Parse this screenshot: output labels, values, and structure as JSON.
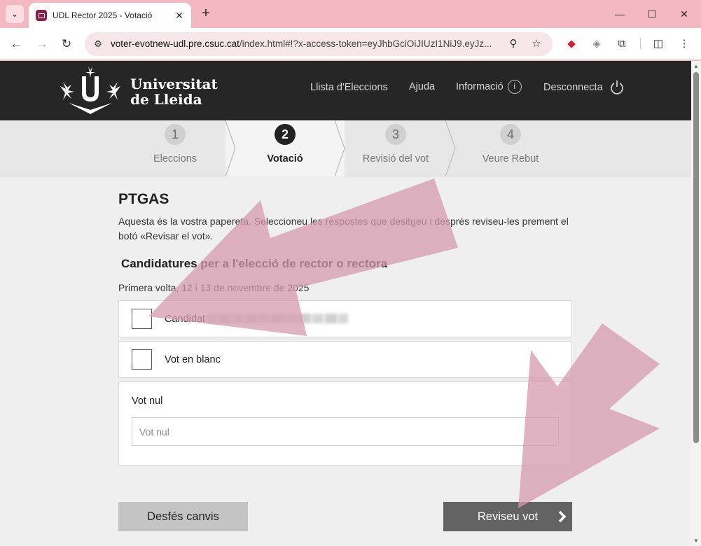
{
  "browser": {
    "tab_title": "UDL Rector 2025 - Votació",
    "url_host": "voter-evotnew-udl.pre.csuc.cat",
    "url_rest": "/index.html#!?x-access-token=eyJhbGciOiJIUzI1NiJ9.eyJz...",
    "icons": [
      "tab-list-icon",
      "close-icon",
      "plus-icon",
      "minimize-icon",
      "maximize-icon",
      "back-icon",
      "forward-icon",
      "reload-icon",
      "site-info-icon",
      "zoom-icon",
      "star-icon",
      "extension-icon",
      "puzzle-icon",
      "profile-icon",
      "menu-icon"
    ]
  },
  "header": {
    "logo_line1": "Universitat",
    "logo_line2": "de Lleida",
    "nav": {
      "elections": "Llista d'Eleccions",
      "help": "Ajuda",
      "info": "Informació",
      "logout": "Desconnecta"
    }
  },
  "steps": [
    {
      "num": "1",
      "label": "Eleccions"
    },
    {
      "num": "2",
      "label": "Votació"
    },
    {
      "num": "3",
      "label": "Revisió del vot"
    },
    {
      "num": "4",
      "label": "Veure Rebut"
    }
  ],
  "ballot": {
    "title": "PTGAS",
    "intro": "Aquesta és la vostra papereta. Seleccioneu les respostes que desitgeu i després reviseu-les prement el botó «Revisar el vot».",
    "subtitle": "Candidatures per a l'elecció de rector o rectora",
    "round": "Primera volta, 12 i 13 de novembre de 2025",
    "options": [
      {
        "label": "Candidat",
        "checked": false
      },
      {
        "label": "Vot en blanc",
        "checked": false
      }
    ],
    "null_vote": {
      "label": "Vot nul",
      "placeholder": "Vot nul",
      "value": ""
    }
  },
  "buttons": {
    "undo": "Desfés canvis",
    "review": "Reviseu vot"
  },
  "colors": {
    "header_bg": "#262626",
    "review_button": "#636363",
    "annotation_arrow": "#d59aad"
  }
}
